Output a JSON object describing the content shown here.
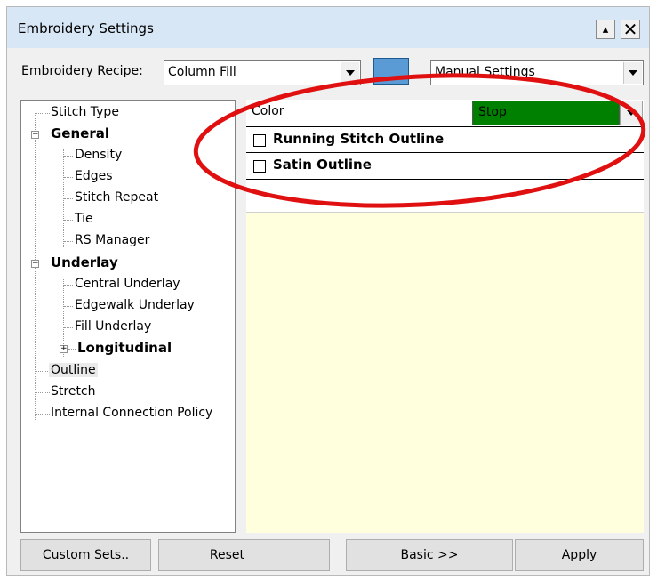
{
  "window": {
    "title": "Embroidery Settings",
    "help_btn": "▴",
    "close_btn": "✕"
  },
  "recipe": {
    "label": "Embroidery Recipe:",
    "value": "Column Fill",
    "mode_value": "Manual Settings",
    "swatch_color": "#5b9bd5"
  },
  "tree": {
    "items": [
      {
        "label": "Stitch Type"
      },
      {
        "label": "General"
      },
      {
        "label": "Density"
      },
      {
        "label": "Edges"
      },
      {
        "label": "Stitch Repeat"
      },
      {
        "label": "Tie"
      },
      {
        "label": "RS Manager"
      },
      {
        "label": "Underlay"
      },
      {
        "label": "Central Underlay"
      },
      {
        "label": "Edgewalk Underlay"
      },
      {
        "label": "Fill Underlay"
      },
      {
        "label": "Longitudinal"
      },
      {
        "label": "Outline"
      },
      {
        "label": "Stretch"
      },
      {
        "label": "Internal Connection Policy"
      }
    ],
    "expander_minus": "−",
    "expander_plus": "+"
  },
  "panel": {
    "color_label": "Color",
    "color_value": "Stop",
    "color_value_bg": "#008000",
    "background": "#ffffdd",
    "options": [
      {
        "label": "Running Stitch Outline",
        "checked": false
      },
      {
        "label": "Satin Outline",
        "checked": false
      }
    ]
  },
  "buttons": {
    "custom_sets": "Custom Sets..",
    "reset": "Reset",
    "basic": "Basic >>",
    "apply": "Apply"
  },
  "annotation": {
    "color": "#e01010"
  }
}
